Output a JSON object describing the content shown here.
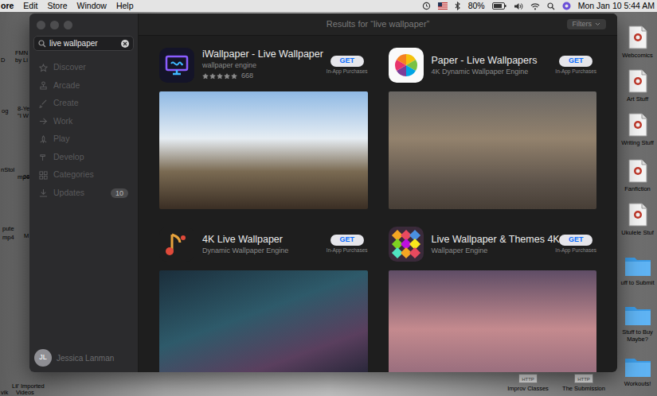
{
  "menu_bar": {
    "app": "ore",
    "menus": [
      "Edit",
      "Store",
      "Window",
      "Help"
    ],
    "battery": "80%",
    "clock": "Mon Jan 10 5:44 AM"
  },
  "desktop": {
    "left_labels": [
      "D",
      "FMN",
      "by Li",
      "og",
      "8-Ye",
      "\"I W",
      "nStol",
      "mp4",
      "20",
      "pute",
      "mp4",
      "M",
      "Lil' Imported",
      "Videos",
      "vik"
    ],
    "right_icons": [
      {
        "label": "Webcomics",
        "kind": "document"
      },
      {
        "label": "Art Stuff",
        "kind": "document"
      },
      {
        "label": "Writing Stuff",
        "kind": "document"
      },
      {
        "label": "Fanfiction",
        "kind": "document"
      },
      {
        "label": "Ukulele Stuf",
        "kind": "document"
      },
      {
        "label": "uff to Submit",
        "kind": "folder"
      },
      {
        "label": "Stuff to Buy Maybe?",
        "kind": "folder"
      },
      {
        "label": "Workouts!",
        "kind": "folder"
      }
    ],
    "bottom_icons": [
      {
        "label": "Improv Classes",
        "badge": "HTTP"
      },
      {
        "label": "The Submission",
        "badge": "HTTP"
      }
    ]
  },
  "window": {
    "title": "Results for “live wallpaper”",
    "filters": "Filters"
  },
  "search": {
    "value": "live wallpaper"
  },
  "sidebar": {
    "items": [
      {
        "label": "Discover",
        "disabled": true
      },
      {
        "label": "Arcade",
        "disabled": true
      },
      {
        "label": "Create",
        "disabled": true
      },
      {
        "label": "Work",
        "disabled": true
      },
      {
        "label": "Play",
        "disabled": true
      },
      {
        "label": "Develop",
        "disabled": true
      },
      {
        "label": "Categories",
        "disabled": true
      },
      {
        "label": "Updates",
        "disabled": true,
        "badge": "10"
      }
    ]
  },
  "account": {
    "initials": "JL",
    "name": "Jessica Lanman"
  },
  "apps": [
    {
      "name": "iWallpaper - Live Wallpaper",
      "subtitle": "wallpaper engine",
      "stars": 5,
      "rating_count": "668",
      "button": "GET",
      "note": "In-App Purchases"
    },
    {
      "name": "Paper - Live Wallpapers",
      "subtitle": "4K Dynamic Wallpaper Engine",
      "button": "GET",
      "note": "In-App Purchases"
    },
    {
      "name": "4K Live Wallpaper",
      "subtitle": "Dynamic Wallpaper Engine",
      "button": "GET",
      "note": "In-App Purchases"
    },
    {
      "name": "Live Wallpaper & Themes 4K",
      "subtitle": "Wallpaper Engine",
      "button": "GET",
      "note": "In-App Purchases"
    }
  ]
}
